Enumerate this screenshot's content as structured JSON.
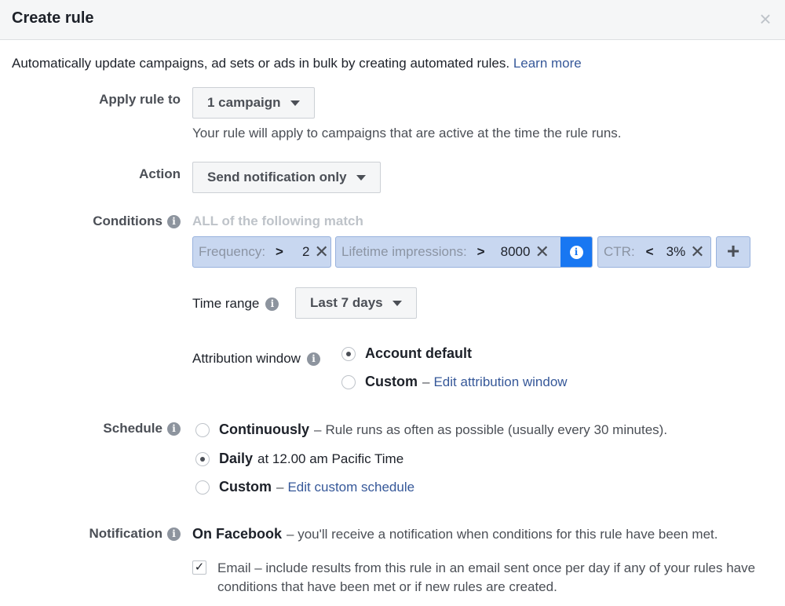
{
  "dialog": {
    "title": "Create rule",
    "close_glyph": "×",
    "intro": "Automatically update campaigns, ad sets or ads in bulk by creating automated rules.",
    "learn_more": "Learn more"
  },
  "apply_rule": {
    "label": "Apply rule to",
    "value": "1 campaign",
    "helper": "Your rule will apply to campaigns that are active at the time the rule runs."
  },
  "action": {
    "label": "Action",
    "value": "Send notification only"
  },
  "conditions": {
    "label": "Conditions",
    "header": "ALL of the following match",
    "tokens": [
      {
        "label": "Frequency:",
        "op": ">",
        "value": "2"
      },
      {
        "label": "Lifetime impressions:",
        "op": ">",
        "value": "8000"
      },
      {
        "label": "CTR:",
        "op": "<",
        "value": "3%"
      }
    ],
    "add_glyph": "+",
    "remove_glyph": "✕",
    "info_glyph": "i"
  },
  "time_range": {
    "label": "Time range",
    "value": "Last 7 days"
  },
  "attribution": {
    "label": "Attribution window",
    "options": [
      {
        "title": "Account default",
        "checked": true
      },
      {
        "title": "Custom",
        "sep": "–",
        "link": "Edit attribution window",
        "checked": false
      }
    ]
  },
  "schedule": {
    "label": "Schedule",
    "options": [
      {
        "title": "Continuously",
        "sep": "–",
        "desc": "Rule runs as often as possible (usually every 30 minutes).",
        "checked": false
      },
      {
        "title": "Daily",
        "desc": "at 12.00 am Pacific Time",
        "checked": true
      },
      {
        "title": "Custom",
        "sep": "–",
        "link": "Edit custom schedule",
        "checked": false
      }
    ]
  },
  "notification": {
    "label": "Notification",
    "on_facebook_title": "On Facebook",
    "on_facebook_desc": "– you'll receive a notification when conditions for this rule have been met.",
    "email_checked": true,
    "email_check_glyph": "✓",
    "email_text": "Email – include results from this rule in an email sent once per day if any of your rules have conditions that have been met or if new rules are created."
  },
  "colors": {
    "link": "#365899",
    "token_bg": "#c8d7f0",
    "info_active": "#1877f2"
  }
}
